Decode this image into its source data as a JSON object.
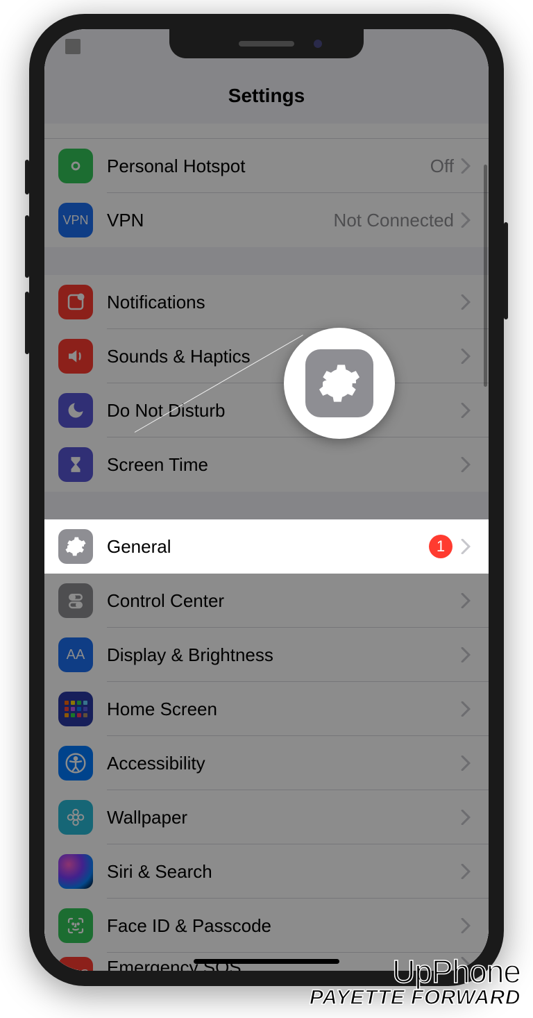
{
  "header": {
    "title": "Settings"
  },
  "group1": {
    "hotspot": {
      "label": "Personal Hotspot",
      "detail": "Off"
    },
    "vpn": {
      "label": "VPN",
      "icon_text": "VPN",
      "detail": "Not Connected"
    }
  },
  "group2": {
    "notifications": {
      "label": "Notifications"
    },
    "sounds": {
      "label": "Sounds & Haptics"
    },
    "dnd": {
      "label": "Do Not Disturb"
    },
    "screentime": {
      "label": "Screen Time"
    }
  },
  "group3": {
    "general": {
      "label": "General",
      "badge": "1"
    },
    "controlcenter": {
      "label": "Control Center"
    },
    "display": {
      "label": "Display & Brightness",
      "icon_text": "AA"
    },
    "homescreen": {
      "label": "Home Screen"
    },
    "accessibility": {
      "label": "Accessibility"
    },
    "wallpaper": {
      "label": "Wallpaper"
    },
    "siri": {
      "label": "Siri & Search"
    },
    "faceid": {
      "label": "Face ID & Passcode"
    },
    "sos": {
      "label": "Emergency SOS",
      "icon_text": "SOS"
    }
  },
  "watermark": {
    "line1": "UpPhone",
    "line2": "PAYETTE FORWARD"
  }
}
